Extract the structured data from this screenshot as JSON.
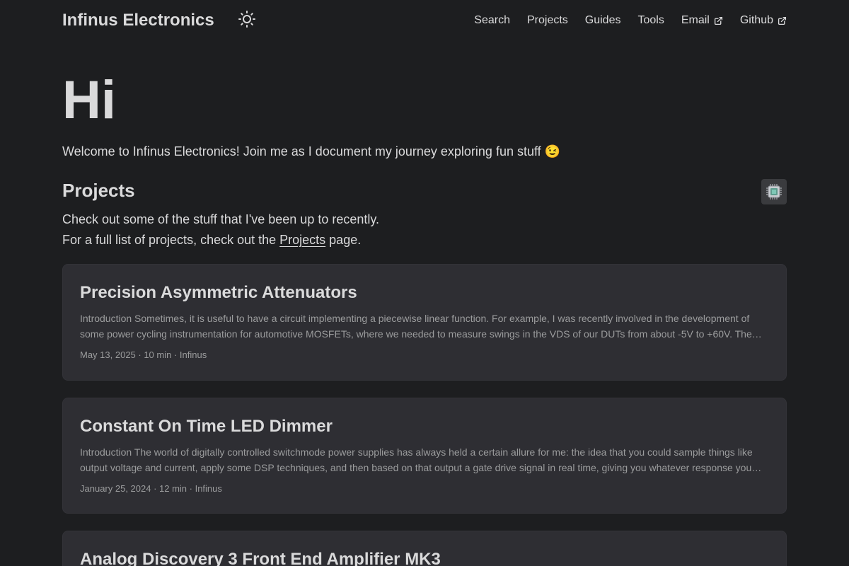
{
  "header": {
    "site_title": "Infinus Electronics",
    "theme_icon": "sun-icon",
    "nav": [
      {
        "label": "Search",
        "external": false
      },
      {
        "label": "Projects",
        "external": false
      },
      {
        "label": "Guides",
        "external": false
      },
      {
        "label": "Tools",
        "external": false
      },
      {
        "label": "Email",
        "external": true
      },
      {
        "label": "Github",
        "external": true
      }
    ]
  },
  "hero": {
    "title": "Hi",
    "text": "Welcome to Infinus Electronics! Join me as I document my journey exploring fun stuff 😉"
  },
  "projects_section": {
    "title": "Projects",
    "badge_icon": "chip-icon",
    "desc_line1": "Check out some of the stuff that I've been up to recently.",
    "desc_line2_before": "For a full list of projects, check out the ",
    "desc_link": "Projects",
    "desc_line2_after": " page."
  },
  "posts": [
    {
      "title": "Precision Asymmetric Attenuators",
      "summary": "Introduction Sometimes, it is useful to have a circuit implementing a piecewise linear function. For example, I was recently involved in the development of some power cycling instrumentation for automotive MOSFETs, where we needed to measure swings in the VDS of our DUTs from about -5V to +60V. The range of interest for the on-state voltage was small while the off-state was large.",
      "meta": "May 13, 2025 · 10 min · Infinus"
    },
    {
      "title": "Constant On Time LED Dimmer",
      "summary": "Introduction The world of digitally controlled switchmode power supplies has always held a certain allure for me: the idea that you could sample things like output voltage and current, apply some DSP techniques, and then based on that output a gate drive signal in real time, giving you whatever response you want.",
      "meta": "January 25, 2024 · 12 min · Infinus"
    },
    {
      "title": "Analog Discovery 3 Front End Amplifier MK3",
      "summary": "",
      "meta": ""
    }
  ]
}
